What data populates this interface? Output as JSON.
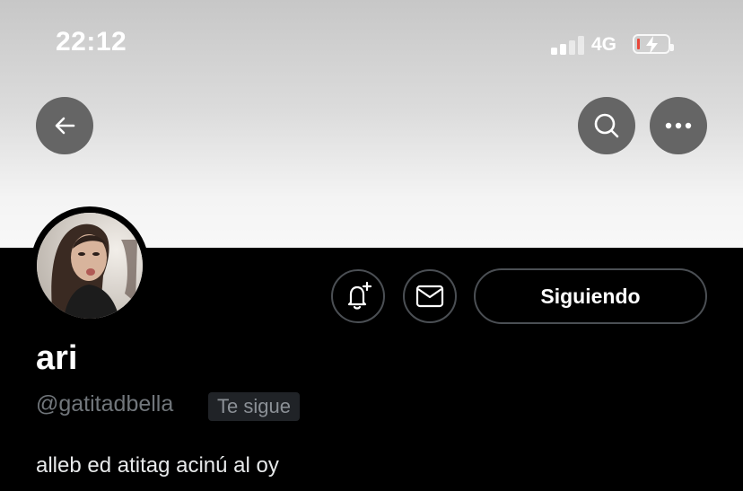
{
  "status_bar": {
    "time": "22:12",
    "network": "4G",
    "signal_bars_active": 2,
    "signal_bars_total": 4,
    "battery_level": 0.08,
    "charging": true
  },
  "header": {
    "back_icon": "arrow-left-icon",
    "search_icon": "search-icon",
    "more_icon": "more-horizontal-icon"
  },
  "profile": {
    "display_name": "ari",
    "handle": "@gatitadbella",
    "follows_you_badge": "Te sigue",
    "bio": "alleb ed atitag acinú al oy",
    "follow_button_label": "Siguiendo",
    "notify_icon": "bell-plus-icon",
    "message_icon": "envelope-icon"
  },
  "colors": {
    "background": "#000000",
    "secondary_text": "#71767b",
    "button_border": "#4b4f54",
    "battery_low": "#e8473a"
  }
}
